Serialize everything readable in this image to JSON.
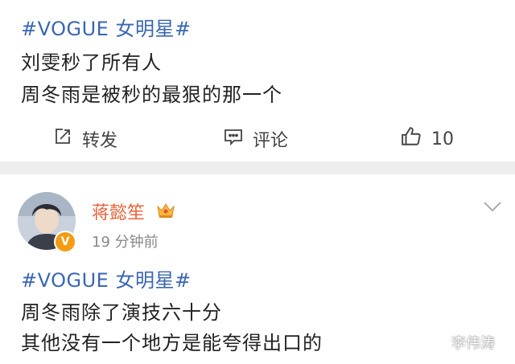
{
  "post1": {
    "hashtag": "#VOGUE 女明星#",
    "lines": [
      "刘雯秒了所有人",
      "周冬雨是被秒的最狠的那一个"
    ],
    "actions": {
      "repost": "转发",
      "comment": "评论",
      "like_count": "10"
    }
  },
  "post2": {
    "username": "蒋懿笙",
    "time": "19 分钟前",
    "hashtag": "#VOGUE 女明星#",
    "lines": [
      "周冬雨除了演技六十分",
      "其他没有一个地方是能夸得出口的"
    ],
    "verified_badge": "V"
  },
  "watermark": "李伟涛",
  "colors": {
    "hashtag": "#3a66b3",
    "username": "#e8633a",
    "separator": "#eeeeee",
    "badge": "#f39c12"
  },
  "icons": [
    "repost-icon",
    "comment-icon",
    "like-icon",
    "crown-icon",
    "chevron-down-icon"
  ]
}
